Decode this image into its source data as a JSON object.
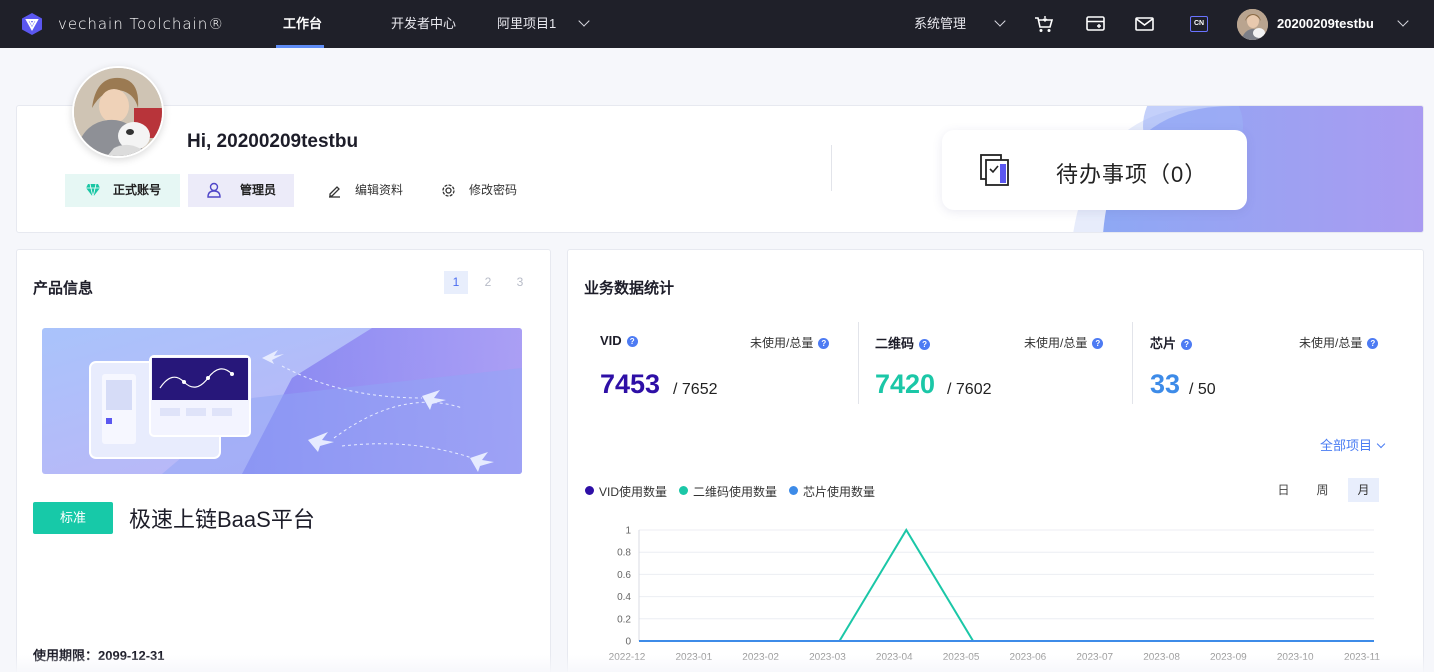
{
  "header": {
    "brand": "vechain Toolchain®",
    "nav": [
      {
        "label": "工作台",
        "active": true
      },
      {
        "label": "开发者中心",
        "active": false
      },
      {
        "label": "阿里项目1",
        "active": false
      }
    ],
    "system_menu": "系统管理",
    "lang_badge": "CN",
    "username": "20200209testbu",
    "icons": [
      "cart-icon",
      "card-icon",
      "mail-icon"
    ]
  },
  "profile": {
    "greeting": "Hi, 20200209testbu",
    "account_type": "正式账号",
    "role": "管理员",
    "edit_profile": "编辑资料",
    "change_password": "修改密码",
    "todo_label": "待办事项（0）"
  },
  "product": {
    "title": "产品信息",
    "pages": [
      "1",
      "2",
      "3"
    ],
    "active_page": "1",
    "badge": "标准",
    "name": "极速上链BaaS平台",
    "expiry": "使用期限：2099-12-31"
  },
  "stats": {
    "title": "业务数据统计",
    "subtitle": "未使用/总量",
    "items": [
      {
        "label": "VID",
        "sub": "未使用/总量",
        "value": "7453",
        "total": "/ 7652",
        "color": "#2e0fa6"
      },
      {
        "label": "二维码",
        "sub": "未使用/总量",
        "value": "7420",
        "total": "/ 7602",
        "color": "#1bc7a7"
      },
      {
        "label": "芯片",
        "sub": "未使用/总量",
        "value": "33",
        "total": "/ 50",
        "color": "#3d8be8"
      }
    ],
    "all_projects": "全部项目",
    "range": [
      "日",
      "周",
      "月"
    ],
    "active_range": "月"
  },
  "chart_data": {
    "type": "line",
    "x": [
      "2022-12",
      "2023-01",
      "2023-02",
      "2023-03",
      "2023-04",
      "2023-05",
      "2023-06",
      "2023-07",
      "2023-08",
      "2023-09",
      "2023-10",
      "2023-11"
    ],
    "yticks": [
      "0",
      "0.2",
      "0.4",
      "0.6",
      "0.8",
      "1"
    ],
    "ylim": [
      0,
      1
    ],
    "legend_position": "top-left",
    "grid": true,
    "series": [
      {
        "name": "VID使用数量",
        "color": "#2e0fa6",
        "values": [
          0,
          0,
          0,
          0,
          0,
          0,
          0,
          0,
          0,
          0,
          0,
          0
        ]
      },
      {
        "name": "二维码使用数量",
        "color": "#1bc7a7",
        "values": [
          0,
          0,
          0,
          0,
          1,
          0,
          0,
          0,
          0,
          0,
          0,
          0
        ]
      },
      {
        "name": "芯片使用数量",
        "color": "#3d8be8",
        "values": [
          0,
          0,
          0,
          0,
          0,
          0,
          0,
          0,
          0,
          0,
          0,
          0
        ]
      }
    ]
  }
}
